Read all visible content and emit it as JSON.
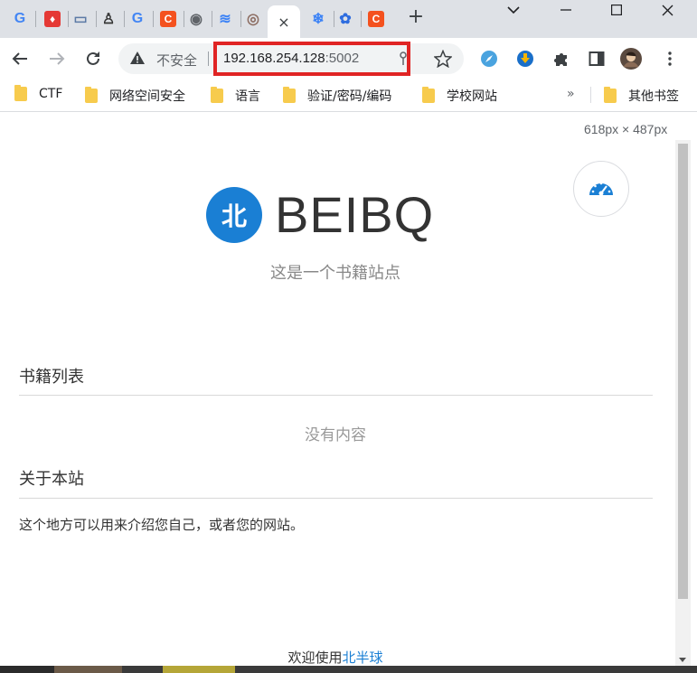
{
  "browser": {
    "tabs": [
      {
        "icon": "google-icon",
        "glyph": "G",
        "color": "#4285f4"
      },
      {
        "icon": "csdn-icon",
        "glyph": "♦",
        "color": "#e53935"
      },
      {
        "icon": "monitor-icon",
        "glyph": "▭",
        "color": "#5c7aa6"
      },
      {
        "icon": "linux-penguin-icon",
        "glyph": "♙",
        "color": "#333333"
      },
      {
        "icon": "google-icon",
        "glyph": "G",
        "color": "#4285f4"
      },
      {
        "icon": "c-orange-icon",
        "glyph": "C",
        "color": "#f4511e"
      },
      {
        "icon": "globe-icon",
        "glyph": "◉",
        "color": "#5f6368"
      },
      {
        "icon": "layers-icon",
        "glyph": "≋",
        "color": "#3b82f6"
      },
      {
        "icon": "location-pin-icon",
        "glyph": "◎",
        "color": "#8d6e63"
      },
      {
        "icon": "snowflake-icon",
        "glyph": "❄",
        "color": "#3b82f6"
      },
      {
        "icon": "paw-icon",
        "glyph": "✿",
        "color": "#2d6cdf"
      },
      {
        "icon": "c-orange-icon",
        "glyph": "C",
        "color": "#f4511e"
      }
    ],
    "active_tab_close": "×",
    "new_tab": "+",
    "address": {
      "security_label": "不安全",
      "host": "192.168.254.128",
      "port": ":5002"
    },
    "bookmarks": [
      {
        "label": "CTF"
      },
      {
        "label": "网络空间安全"
      },
      {
        "label": "语言"
      },
      {
        "label": "验证/密码/编码"
      },
      {
        "label": "学校网站"
      }
    ],
    "more_bookmarks": "»",
    "other_bookmarks": "其他书签",
    "viewport_size": "618px × 487px"
  },
  "page": {
    "logo_glyph": "北",
    "site_name": "BEIBQ",
    "tagline": "这是一个书籍站点",
    "book_list_title": "书籍列表",
    "empty_text": "没有内容",
    "about_title": "关于本站",
    "about_text": "这个地方可以用来介绍您自己，或者您的网站。",
    "footer_prefix": "欢迎使用",
    "footer_link": "北半球"
  },
  "colors": {
    "accent": "#1a7fd4",
    "highlight_box": "#e02424"
  }
}
